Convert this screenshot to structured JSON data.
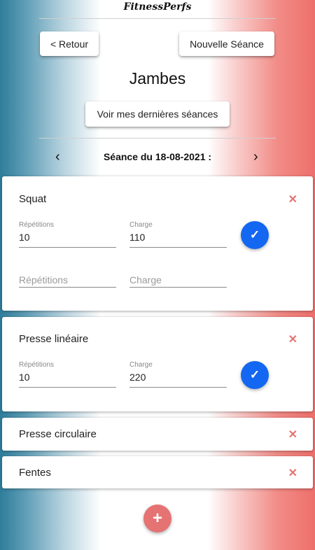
{
  "app": {
    "brand": "FitnessPerfs"
  },
  "header": {
    "back_label": "< Retour",
    "new_session_label": "Nouvelle Séance"
  },
  "page": {
    "title": "Jambes",
    "history_label": "Voir mes dernières séances"
  },
  "session": {
    "label": "Séance du 18-08-2021 :",
    "prev_icon": "chevron-left-icon",
    "next_icon": "chevron-right-icon"
  },
  "exercises": [
    {
      "name": "Squat",
      "sets": [
        {
          "reps_label": "Répétitions",
          "reps": "10",
          "load_label": "Charge",
          "load": "110"
        }
      ],
      "new_set": {
        "reps_placeholder": "Répétitions",
        "load_placeholder": "Charge"
      }
    },
    {
      "name": "Presse linéaire",
      "sets": [
        {
          "reps_label": "Répétitions",
          "reps": "10",
          "load_label": "Charge",
          "load": "220"
        }
      ]
    },
    {
      "name": "Presse circulaire"
    },
    {
      "name": "Fentes"
    }
  ],
  "icons": {
    "delete": "close-icon",
    "confirm": "check-icon",
    "add": "plus-icon"
  },
  "colors": {
    "accent_blue": "#1467f0",
    "delete_red": "#e57373",
    "fab_red": "#e57373"
  }
}
